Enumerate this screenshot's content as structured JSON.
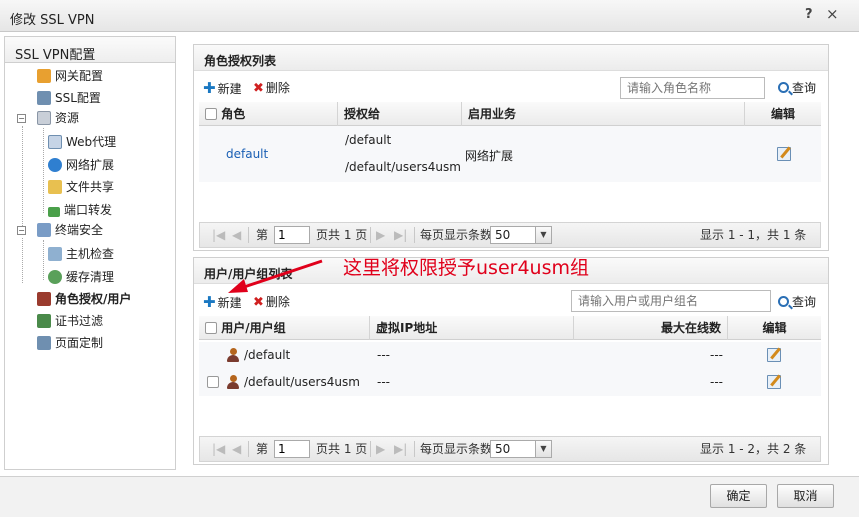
{
  "window": {
    "title": "修改 SSL VPN",
    "help": "?",
    "close": "×"
  },
  "sidebar": {
    "header": "SSL VPN配置",
    "items": [
      {
        "label": "网关配置",
        "icon": "gateway-config-icon"
      },
      {
        "label": "SSL配置",
        "icon": "ssl-config-icon"
      },
      {
        "label": "资源",
        "icon": "resource-icon"
      },
      {
        "label": "Web代理",
        "icon": "web-proxy-icon"
      },
      {
        "label": "网络扩展",
        "icon": "network-extension-icon"
      },
      {
        "label": "文件共享",
        "icon": "file-share-icon"
      },
      {
        "label": "端口转发",
        "icon": "port-forward-icon"
      },
      {
        "label": "终端安全",
        "icon": "endpoint-security-icon"
      },
      {
        "label": "主机检查",
        "icon": "host-check-icon"
      },
      {
        "label": "缓存清理",
        "icon": "cache-clean-icon"
      },
      {
        "label": "角色授权/用户",
        "icon": "role-user-icon"
      },
      {
        "label": "证书过滤",
        "icon": "cert-filter-icon"
      },
      {
        "label": "页面定制",
        "icon": "page-custom-icon"
      }
    ],
    "expanders": [
      "−",
      "−"
    ]
  },
  "role_panel": {
    "title": "角色授权列表",
    "new_label": "新建",
    "delete_label": "删除",
    "search_placeholder": "请输入角色名称",
    "query_label": "查询",
    "columns": [
      "角色",
      "授权给",
      "启用业务",
      "编辑"
    ],
    "rows": [
      {
        "role": "default",
        "grant_to_1": "/default",
        "grant_to_2": "/default/users4usm",
        "service": "网络扩展"
      }
    ],
    "pager": {
      "page_prefix": "第",
      "page_value": "1",
      "page_total": "页共 1 页",
      "per_page": "每页显示条数",
      "per_page_value": "50",
      "summary": "显示 1 - 1，共 1 条"
    }
  },
  "user_panel": {
    "title": "用户/用户组列表",
    "new_label": "新建",
    "delete_label": "删除",
    "search_placeholder": "请输入用户或用户组名",
    "query_label": "查询",
    "columns": [
      "用户/用户组",
      "虚拟IP地址",
      "最大在线数",
      "编辑"
    ],
    "rows": [
      {
        "name": "/default",
        "ip": "---",
        "max": "---"
      },
      {
        "name": "/default/users4usm",
        "ip": "---",
        "max": "---"
      }
    ],
    "pager": {
      "page_prefix": "第",
      "page_value": "1",
      "page_total": "页共 1 页",
      "per_page": "每页显示条数",
      "per_page_value": "50",
      "summary": "显示 1 - 2，共 2 条"
    }
  },
  "annotation": "这里将权限授予user4usm组",
  "buttons": {
    "ok": "确定",
    "cancel": "取消"
  },
  "colors": {
    "link": "#1a5fb4",
    "annotation": "#e0001b",
    "new_plus": "#1a78c2",
    "delete_x": "#d02020"
  }
}
